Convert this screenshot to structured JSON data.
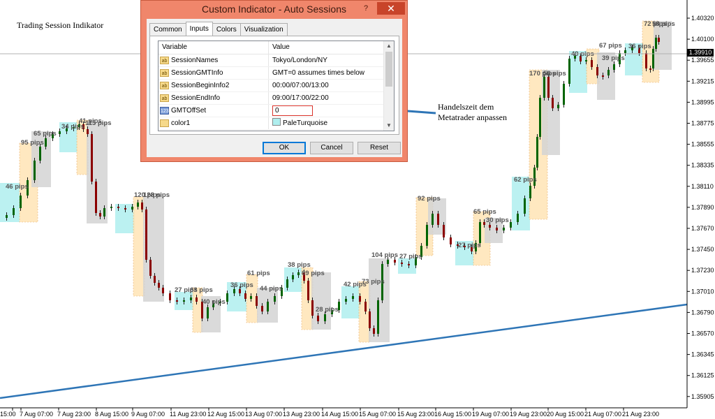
{
  "chart": {
    "title": "Trading Session Indikator",
    "current_price": "1.39910",
    "price_axis": [
      "1.40320",
      "1.40100",
      "1.39655",
      "1.39215",
      "1.38995",
      "1.38775",
      "1.38555",
      "1.38335",
      "1.38110",
      "1.37890",
      "1.37670",
      "1.37450",
      "1.37230",
      "1.37010",
      "1.36790",
      "1.36570",
      "1.36345",
      "1.36125",
      "1.35905"
    ],
    "time_axis": [
      "15:00",
      "7 Aug 07:00",
      "7 Aug 23:00",
      "8 Aug 15:00",
      "9 Aug 07:00",
      "11 Aug 23:00",
      "12 Aug 15:00",
      "13 Aug 07:00",
      "13 Aug 23:00",
      "14 Aug 15:00",
      "15 Aug 07:00",
      "15 Aug 23:00",
      "16 Aug 15:00",
      "19 Aug 07:00",
      "19 Aug 23:00",
      "20 Aug 15:00",
      "21 Aug 07:00",
      "21 Aug 23:00"
    ],
    "session_labels": [
      "46 pips",
      "95 pips",
      "65 pips",
      "34 pips",
      "41 pips",
      "115 pips",
      "120 pips",
      "128 pips",
      "27 pips",
      "63 pips",
      "40 pips",
      "36 pips",
      "61 pips",
      "44 pips",
      "38 pips",
      "69 pips",
      "28 pips",
      "42 pips",
      "73 pips",
      "104 pips",
      "27 pips",
      "92 pips",
      "27 pips",
      "65 pips",
      "30 pips",
      "62 pips",
      "170 pips",
      "56 pips",
      "49 pips",
      "67 pips",
      "39 pips",
      "36 pips",
      "72 pips",
      "58 pips"
    ],
    "colors": {
      "tokyo": "#AFEEEE",
      "london": "#FFE4B5",
      "ny": "#D3D3D3",
      "overlap": "#D8BFD8",
      "bull": "#006400",
      "bear": "#8B0000",
      "trendline": "#2E75B6"
    }
  },
  "annotation": {
    "line1": "Handelszeit dem",
    "line2": "Metatrader anpassen"
  },
  "dialog": {
    "title": "Custom Indicator - Auto Sessions",
    "help_icon": "help-icon",
    "close_icon": "close-icon",
    "tabs": [
      "Common",
      "Inputs",
      "Colors",
      "Visualization"
    ],
    "active_tab": "Inputs",
    "grid": {
      "header_variable": "Variable",
      "header_value": "Value",
      "rows": [
        {
          "icon": "ab",
          "variable": "SessionNames",
          "value": "Tokyo/London/NY"
        },
        {
          "icon": "ab",
          "variable": "SessionGMTInfo",
          "value": "GMT=0 assumes times below"
        },
        {
          "icon": "ab",
          "variable": "SessionBeginInfo2",
          "value": "00:00/07:00/13:00"
        },
        {
          "icon": "ab",
          "variable": "SessionEndInfo",
          "value": "09:00/17:00/22:00"
        },
        {
          "icon": "123",
          "variable": "GMTOffSet",
          "value": "0"
        },
        {
          "icon": "clr",
          "variable": "color1",
          "value": "PaleTurquoise"
        }
      ]
    },
    "buttons": {
      "ok": "OK",
      "cancel": "Cancel",
      "reset": "Reset"
    }
  }
}
